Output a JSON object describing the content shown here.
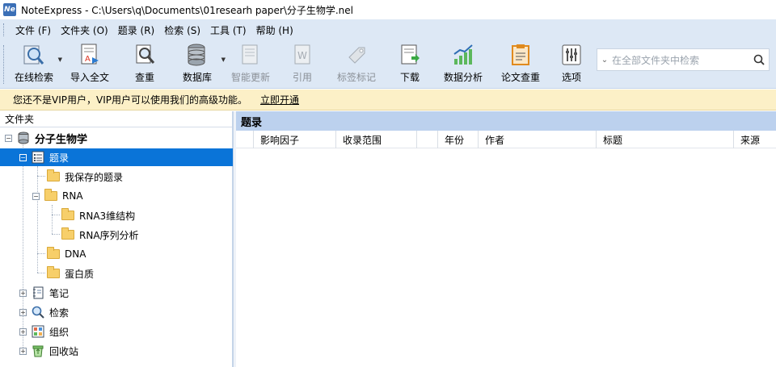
{
  "window": {
    "title": "NoteExpress - C:\\Users\\q\\Documents\\01researh paper\\分子生物学.nel",
    "logo_text": "Ne"
  },
  "menu": [
    "文件 (F)",
    "文件夹 (O)",
    "题录 (R)",
    "检索 (S)",
    "工具 (T)",
    "帮助 (H)"
  ],
  "toolbar": {
    "online_search": "在线检索",
    "import_fulltext": "导入全文",
    "dedupe": "查重",
    "database": "数据库",
    "smart_update": "智能更新",
    "cite": "引用",
    "tag": "标签标记",
    "download": "下载",
    "data_analysis": "数据分析",
    "paper_check": "论文查重",
    "options": "选项",
    "search_placeholder": "在全部文件夹中检索"
  },
  "vip": {
    "message": "您还不是VIP用户，VIP用户可以使用我们的高级功能。",
    "link": "立即开通"
  },
  "tree": {
    "header": "文件夹",
    "root": "分子生物学",
    "records": "题录",
    "saved_records": "我保存的题录",
    "rna": "RNA",
    "rna3d": "RNA3维结构",
    "rna_seq": "RNA序列分析",
    "dna": "DNA",
    "protein": "蛋白质",
    "notes": "笔记",
    "search": "检索",
    "organize": "组织",
    "recycle": "回收站"
  },
  "content": {
    "title": "题录",
    "columns": [
      "影响因子",
      "收录范围",
      "年份",
      "作者",
      "标题",
      "来源"
    ]
  },
  "colors": {
    "selection": "#0a74d8",
    "toolbar_bg": "#dde8f5",
    "vip_bg": "#fcf0c7",
    "content_title_bg": "#bcd1ee"
  }
}
